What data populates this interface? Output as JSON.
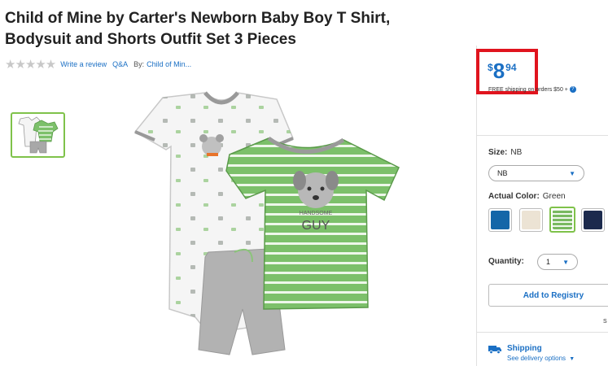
{
  "product": {
    "title_line1": "Child of Mine by Carter's Newborn Baby Boy T Shirt,",
    "title_line2": "Bodysuit and Shorts Outfit Set 3 Pieces",
    "stars": "★★★★★",
    "write_review": "Write a review",
    "qa": "Q&A",
    "by_label": "By:",
    "brand_link": "Child of Min...",
    "tshirt_text1": "HANDSOME",
    "tshirt_text2": "GUY"
  },
  "pricing": {
    "currency": "$",
    "dollars": "8",
    "cents": "94",
    "shipping_note": "FREE shipping on orders $50 +",
    "help_icon_text": "?"
  },
  "options": {
    "size_label": "Size:",
    "size_value": "NB",
    "size_select": "NB",
    "color_label": "Actual Color:",
    "color_value": "Green",
    "swatches": [
      {
        "name": "blue",
        "color": "#1466a8"
      },
      {
        "name": "oatmeal",
        "color": "#ece3d4"
      },
      {
        "name": "green-stripe",
        "color": "#79b960"
      },
      {
        "name": "navy",
        "color": "#1c2a4d"
      }
    ],
    "quantity_label": "Quantity:",
    "quantity_value": "1"
  },
  "actions": {
    "registry_label": "Add to Registry",
    "truncated_s": "S"
  },
  "shipping": {
    "title": "Shipping",
    "sub": "See delivery options"
  },
  "colors": {
    "accent_blue": "#1a6fc4",
    "highlight_red": "#e0141e",
    "selected_green": "#7fc24a",
    "shirt_green": "#7cc06a"
  }
}
